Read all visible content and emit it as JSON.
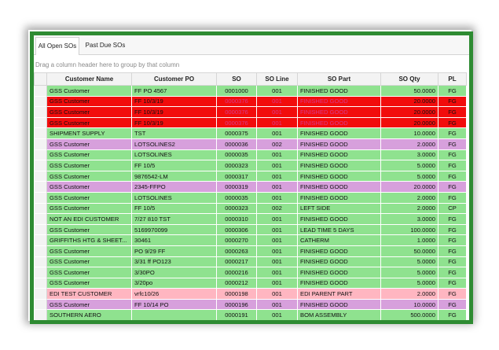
{
  "tabs": [
    "All Open SOs",
    "Past Due SOs"
  ],
  "group_hint": "Drag a column header here to group by that column",
  "columns": [
    "Customer Name",
    "Customer PO",
    "SO",
    "SO Line",
    "SO Part",
    "SO Qty",
    "PL"
  ],
  "row_colors": {
    "green": "#8fe28f",
    "red": "#f20c0c",
    "purple": "#d7a0dc",
    "pink": "#ffb6c1"
  },
  "rows": [
    {
      "color": "green",
      "customer": "GSS Customer",
      "po": "FF PO 4567",
      "so": "0001000",
      "line": "001",
      "part": "FINISHED GOOD",
      "qty": "50.0000",
      "pl": "FG"
    },
    {
      "color": "red",
      "customer": "GSS Customer",
      "po": "FF 10/3/19",
      "so": "0000376",
      "line": "001",
      "part": "FINISHED GOOD",
      "qty": "20.0000",
      "pl": "FG"
    },
    {
      "color": "red",
      "customer": "GSS Customer",
      "po": "FF 10/3/19",
      "so": "0000376",
      "line": "001",
      "part": "FINISHED GOOD",
      "qty": "20.0000",
      "pl": "FG"
    },
    {
      "color": "red",
      "customer": "GSS Customer",
      "po": "FF 10/3/19",
      "so": "0000376",
      "line": "001",
      "part": "FINISHED GOOD",
      "qty": "20.0000",
      "pl": "FG"
    },
    {
      "color": "green",
      "customer": "SHIPMENT SUPPLY",
      "po": "TST",
      "so": "0000375",
      "line": "001",
      "part": "FINISHED GOOD",
      "qty": "10.0000",
      "pl": "FG"
    },
    {
      "color": "purple",
      "customer": "GSS Customer",
      "po": "LOTSOLINES2",
      "so": "0000036",
      "line": "002",
      "part": "FINISHED GOOD",
      "qty": "2.0000",
      "pl": "FG"
    },
    {
      "color": "green",
      "customer": "GSS Customer",
      "po": "LOTSOLINES",
      "so": "0000035",
      "line": "001",
      "part": "FINISHED GOOD",
      "qty": "3.0000",
      "pl": "FG"
    },
    {
      "color": "green",
      "customer": "GSS Customer",
      "po": "FF 10/5",
      "so": "0000323",
      "line": "001",
      "part": "FINISHED GOOD",
      "qty": "5.0000",
      "pl": "FG"
    },
    {
      "color": "green",
      "customer": "GSS Customer",
      "po": "9876542-LM",
      "so": "0000317",
      "line": "001",
      "part": "FINISHED GOOD",
      "qty": "5.0000",
      "pl": "FG"
    },
    {
      "color": "purple",
      "customer": "GSS Customer",
      "po": "2345-FFPO",
      "so": "0000319",
      "line": "001",
      "part": "FINISHED GOOD",
      "qty": "20.0000",
      "pl": "FG"
    },
    {
      "color": "green",
      "customer": "GSS Customer",
      "po": "LOTSOLINES",
      "so": "0000035",
      "line": "001",
      "part": "FINISHED GOOD",
      "qty": "2.0000",
      "pl": "FG"
    },
    {
      "color": "green",
      "customer": "GSS Customer",
      "po": "FF 10/5",
      "so": "0000323",
      "line": "002",
      "part": "LEFT SIDE",
      "qty": "2.0000",
      "pl": "CP"
    },
    {
      "color": "green",
      "customer": "NOT AN EDI CUSTOMER",
      "po": "7/27 810 TST",
      "so": "0000310",
      "line": "001",
      "part": "FINISHED GOOD",
      "qty": "3.0000",
      "pl": "FG"
    },
    {
      "color": "green",
      "customer": "GSS Customer",
      "po": "5169970099",
      "so": "0000306",
      "line": "001",
      "part": "LEAD TIME 5 DAYS",
      "qty": "100.0000",
      "pl": "FG"
    },
    {
      "color": "green",
      "customer": "GRIFFITHS HTG & SHEET...",
      "po": "30461",
      "so": "0000270",
      "line": "001",
      "part": "CATHERM",
      "qty": "1.0000",
      "pl": "FG"
    },
    {
      "color": "green",
      "customer": "GSS Customer",
      "po": "PO 9/29 FF",
      "so": "0000263",
      "line": "001",
      "part": "FINISHED GOOD",
      "qty": "50.0000",
      "pl": "FG"
    },
    {
      "color": "green",
      "customer": "GSS Customer",
      "po": "3/31 ff PO123",
      "so": "0000217",
      "line": "001",
      "part": "FINISHED GOOD",
      "qty": "5.0000",
      "pl": "FG"
    },
    {
      "color": "green",
      "customer": "GSS Customer",
      "po": "3/30PO",
      "so": "0000216",
      "line": "001",
      "part": "FINISHED GOOD",
      "qty": "5.0000",
      "pl": "FG"
    },
    {
      "color": "green",
      "customer": "GSS Customer",
      "po": "3/20po",
      "so": "0000212",
      "line": "001",
      "part": "FINISHED GOOD",
      "qty": "5.0000",
      "pl": "FG"
    },
    {
      "color": "pink",
      "customer": "EDI TEST CUSTOMER",
      "po": "vrfc10/26",
      "so": "0000198",
      "line": "001",
      "part": "EDI PARENT PART",
      "qty": "2.0000",
      "pl": "FG"
    },
    {
      "color": "purple",
      "customer": "GSS Customer",
      "po": "FF 10/14 PO",
      "so": "0000196",
      "line": "001",
      "part": "FINISHED GOOD",
      "qty": "10.0000",
      "pl": "FG"
    },
    {
      "color": "green",
      "customer": "SOUTHERN AERO",
      "po": "",
      "so": "0000191",
      "line": "001",
      "part": "BOM ASSEMBLY",
      "qty": "500.0000",
      "pl": "FG"
    }
  ]
}
